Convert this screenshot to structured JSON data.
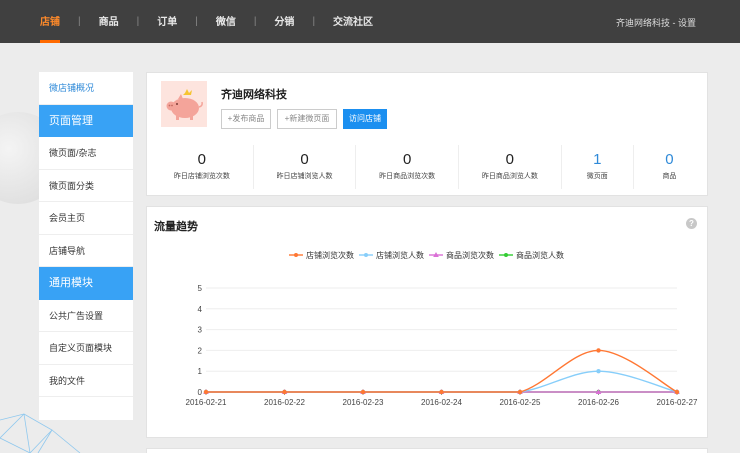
{
  "topnav": {
    "items": [
      {
        "label": "店铺",
        "active": true
      },
      {
        "label": "商品"
      },
      {
        "label": "订单"
      },
      {
        "label": "微信"
      },
      {
        "label": "分销"
      },
      {
        "label": "交流社区"
      }
    ],
    "separator": "|",
    "account": "齐迪网络科技",
    "account_sep": " - ",
    "settings": "设置"
  },
  "sidebar": {
    "overview": "微店铺概况",
    "group1": "页面管理",
    "group1_items": [
      "微页面/杂志",
      "微页面分类",
      "会员主页",
      "店铺导航"
    ],
    "group2": "通用模块",
    "group2_items": [
      "公共广告设置",
      "自定义页面模块",
      "我的文件"
    ]
  },
  "shop": {
    "name": "齐迪网络科技",
    "btn_publish": "+发布商品",
    "btn_new_page": "+新建微页面",
    "btn_visit": "访问店铺",
    "stats": [
      {
        "value": "0",
        "label": "昨日店铺浏览次数"
      },
      {
        "value": "0",
        "label": "昨日店铺浏览人数"
      },
      {
        "value": "0",
        "label": "昨日商品浏览次数"
      },
      {
        "value": "0",
        "label": "昨日商品浏览人数"
      },
      {
        "value": "1",
        "label": "微页面",
        "link": true
      },
      {
        "value": "0",
        "label": "商品",
        "link": true
      }
    ]
  },
  "chart": {
    "title": "流量趋势",
    "help": "?"
  },
  "chart_data": {
    "type": "line",
    "x": [
      "2016-02-21",
      "2016-02-22",
      "2016-02-23",
      "2016-02-24",
      "2016-02-25",
      "2016-02-26",
      "2016-02-27"
    ],
    "ylim": [
      0,
      5
    ],
    "yticks": [
      0,
      1,
      2,
      3,
      4,
      5
    ],
    "grid": true,
    "legend": "top-center",
    "smooth": true,
    "series": [
      {
        "name": "店铺浏览次数",
        "color": "#ff7733",
        "marker": "circle",
        "values": [
          0,
          0,
          0,
          0,
          0,
          2,
          0
        ]
      },
      {
        "name": "店铺浏览人数",
        "color": "#87cefa",
        "marker": "circle",
        "values": [
          0,
          0,
          0,
          0,
          0,
          1,
          0
        ]
      },
      {
        "name": "商品浏览次数",
        "color": "#da70d6",
        "marker": "triangle",
        "values": [
          0,
          0,
          0,
          0,
          0,
          0,
          0
        ]
      },
      {
        "name": "商品浏览人数",
        "color": "#32cd32",
        "marker": "circle",
        "values": [
          0,
          0,
          0,
          0,
          0,
          0,
          0
        ]
      }
    ]
  }
}
